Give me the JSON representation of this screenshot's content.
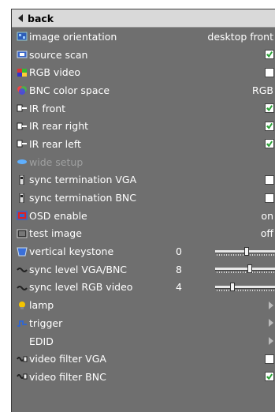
{
  "menu": {
    "back_label": "back",
    "items": [
      {
        "label": "image orientation",
        "icon": "image-orientation-icon",
        "value": "desktop front"
      },
      {
        "label": "source scan",
        "icon": "source-scan-icon",
        "checked": true
      },
      {
        "label": "RGB video",
        "icon": "rgb-video-icon",
        "checked": false
      },
      {
        "label": "BNC color space",
        "icon": "bnc-color-space-icon",
        "value": "RGB"
      },
      {
        "label": "IR front",
        "icon": "ir-front-icon",
        "checked": true
      },
      {
        "label": "IR rear right",
        "icon": "ir-rear-right-icon",
        "checked": true
      },
      {
        "label": "IR rear left",
        "icon": "ir-rear-left-icon",
        "checked": true
      },
      {
        "label": "wide setup",
        "icon": "wide-setup-icon",
        "disabled": true
      },
      {
        "label": "sync termination VGA",
        "icon": "sync-termination-vga-icon",
        "checked": false
      },
      {
        "label": "sync termination BNC",
        "icon": "sync-termination-bnc-icon",
        "checked": false
      },
      {
        "label": "OSD enable",
        "icon": "osd-enable-icon",
        "value": "on"
      },
      {
        "label": "test image",
        "icon": "test-image-icon",
        "value": "off"
      },
      {
        "label": "vertical keystone",
        "icon": "vertical-keystone-icon",
        "num": "0",
        "slider": 0.5
      },
      {
        "label": "sync level VGA/BNC",
        "icon": "sync-level-vga-bnc-icon",
        "num": "8",
        "slider": 0.55
      },
      {
        "label": "sync level RGB video",
        "icon": "sync-level-rgb-video-icon",
        "num": "4",
        "slider": 0.25
      },
      {
        "label": "lamp",
        "icon": "lamp-icon",
        "submenu": true
      },
      {
        "label": "trigger",
        "icon": "trigger-icon",
        "submenu": true
      },
      {
        "label": "EDID",
        "icon": "",
        "submenu": true
      },
      {
        "label": "video filter VGA",
        "icon": "video-filter-vga-icon",
        "checked": false
      },
      {
        "label": "video filter BNC",
        "icon": "video-filter-bnc-icon",
        "checked": true
      }
    ]
  },
  "colors": {
    "menu_bg": "#6f6f6f",
    "header_bg": "#d9d9d9",
    "check_green": "#2aa236",
    "disabled_text": "#9fa0a0"
  }
}
